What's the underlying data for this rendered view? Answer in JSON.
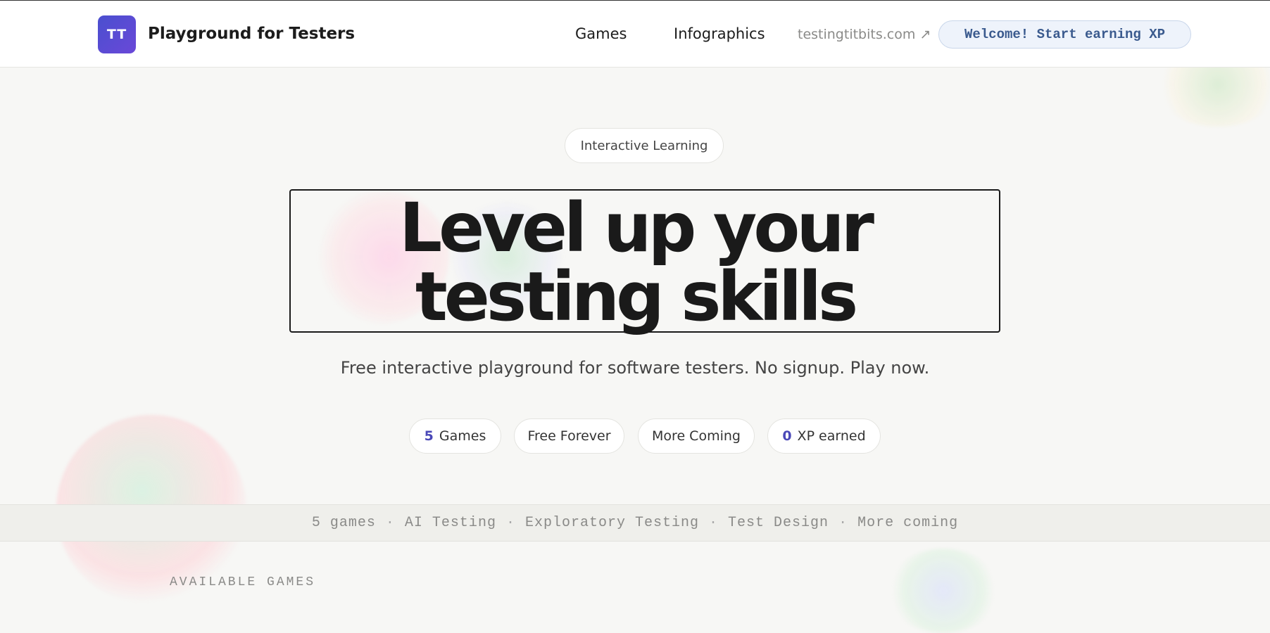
{
  "header": {
    "logo_text": "TT",
    "brand": "Playground for Testers",
    "nav": {
      "games": "Games",
      "infographics": "Infographics",
      "external": "testingtitbits.com ↗"
    },
    "xp_welcome": "Welcome! Start earning XP"
  },
  "hero": {
    "tag": "Interactive Learning",
    "title_line1": "Level up your",
    "title_line2": "testing skills",
    "subtitle": "Free interactive playground for software testers. No signup. Play now."
  },
  "stats": {
    "games_count": "5",
    "games_label": "Games",
    "free": "Free Forever",
    "more": "More Coming",
    "xp_count": "0",
    "xp_label": "XP earned"
  },
  "topics": [
    "5 games",
    "AI Testing",
    "Exploratory Testing",
    "Test Design",
    "More coming"
  ],
  "sections": {
    "available_games": "AVAILABLE GAMES"
  },
  "colors": {
    "accent": "#4a48b8",
    "logo": "#5a4cd4",
    "xp_text": "#3a5a8e"
  }
}
